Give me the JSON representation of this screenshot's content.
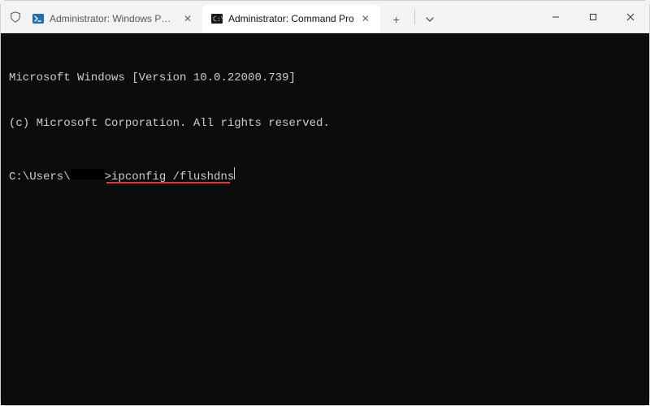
{
  "window": {
    "tabs": [
      {
        "label": "Administrator: Windows Powe",
        "icon": "powershell-icon",
        "active": false
      },
      {
        "label": "Administrator: Command Pro",
        "icon": "cmd-icon",
        "active": true
      }
    ],
    "controls": {
      "minimize": "—",
      "maximize": "☐",
      "close": "✕"
    },
    "new_tab_label": "+",
    "dropdown_label": "⌄"
  },
  "terminal": {
    "header_line1": "Microsoft Windows [Version 10.0.22000.739]",
    "header_line2": "(c) Microsoft Corporation. All rights reserved.",
    "prompt_prefix": "C:\\Users\\",
    "prompt_gt": ">",
    "command": "ipconfig /flushdns"
  },
  "colors": {
    "bg": "#0c0c0c",
    "fg": "#cccccc",
    "annotation": "#e13a3a",
    "titlebar": "#f3f3f3"
  }
}
